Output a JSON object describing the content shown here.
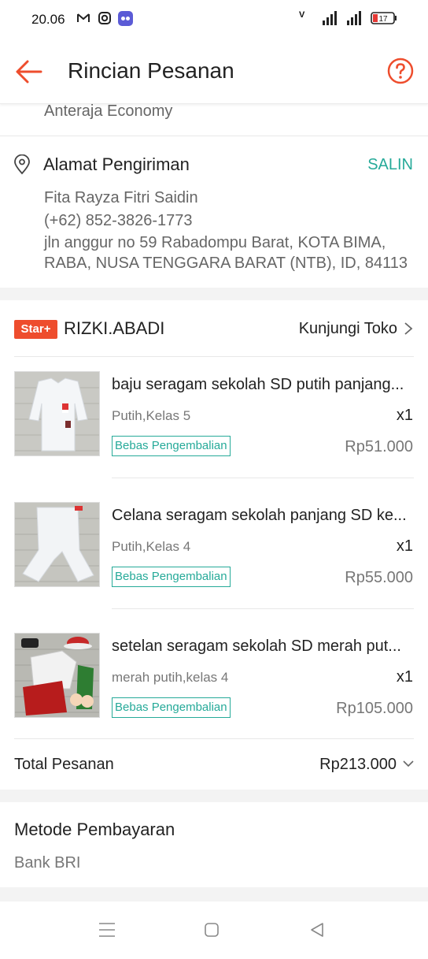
{
  "status_bar": {
    "time": "20.06",
    "battery": "17"
  },
  "header": {
    "title": "Rincian Pesanan"
  },
  "shipping": {
    "courier": "Anteraja Economy"
  },
  "address": {
    "title": "Alamat Pengiriman",
    "copy_label": "SALIN",
    "name": "Fita Rayza Fitri Saidin",
    "phone": "(+62) 852-3826-1773",
    "line1": "jln anggur no 59 Rabadompu Barat, KOTA BIMA,",
    "line2": "RABA, NUSA TENGGARA BARAT (NTB), ID, 84113"
  },
  "shop": {
    "badge": "Star+",
    "name": "RIZKI.ABADI",
    "visit_label": "Kunjungi Toko"
  },
  "products": [
    {
      "name": "baju seragam sekolah SD putih panjang...",
      "variation": "Putih,Kelas 5",
      "qty": "x1",
      "badge": "Bebas Pengembalian",
      "price": "Rp51.000"
    },
    {
      "name": "Celana seragam sekolah panjang SD ke...",
      "variation": "Putih,Kelas 4",
      "qty": "x1",
      "badge": "Bebas Pengembalian",
      "price": "Rp55.000"
    },
    {
      "name": "setelan seragam sekolah SD merah put...",
      "variation": "merah putih,kelas 4",
      "qty": "x1",
      "badge": "Bebas Pengembalian",
      "price": "Rp105.000"
    }
  ],
  "total": {
    "label": "Total Pesanan",
    "value": "Rp213.000"
  },
  "payment": {
    "title": "Metode Pembayaran",
    "value": "Bank BRI"
  },
  "colors": {
    "brand": "#ee4d2d",
    "teal": "#26aa99"
  }
}
